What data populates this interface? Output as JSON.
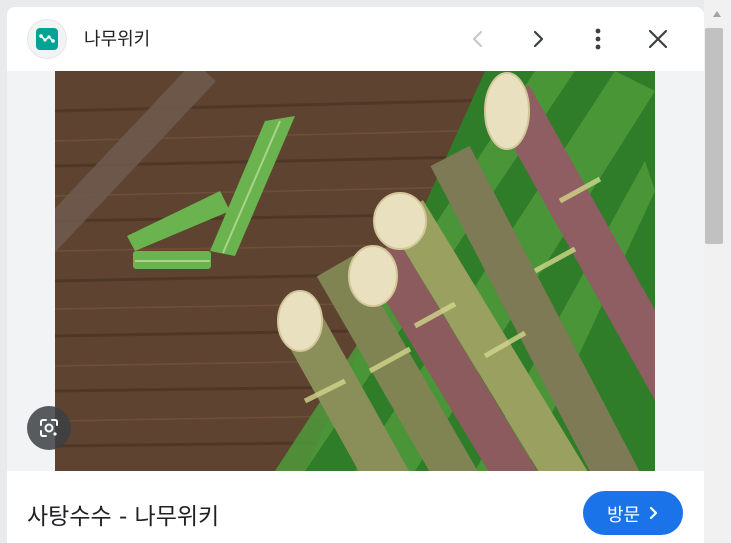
{
  "header": {
    "site_name": "나무위키",
    "favicon_icon": "namuwiki-logo-icon",
    "buttons": {
      "prev_icon": "chevron-left-icon",
      "next_icon": "chevron-right-icon",
      "more_icon": "more-vert-icon",
      "close_icon": "close-icon"
    }
  },
  "image": {
    "subject_icon": "sugarcane-photo",
    "lens_icon": "google-lens-icon"
  },
  "footer": {
    "page_title": "사탕수수 - 나무위키",
    "visit_label": "방문",
    "visit_icon": "chevron-right-icon"
  },
  "colors": {
    "accent": "#1a73e8",
    "favicon": "#00a495",
    "text": "#202124"
  }
}
